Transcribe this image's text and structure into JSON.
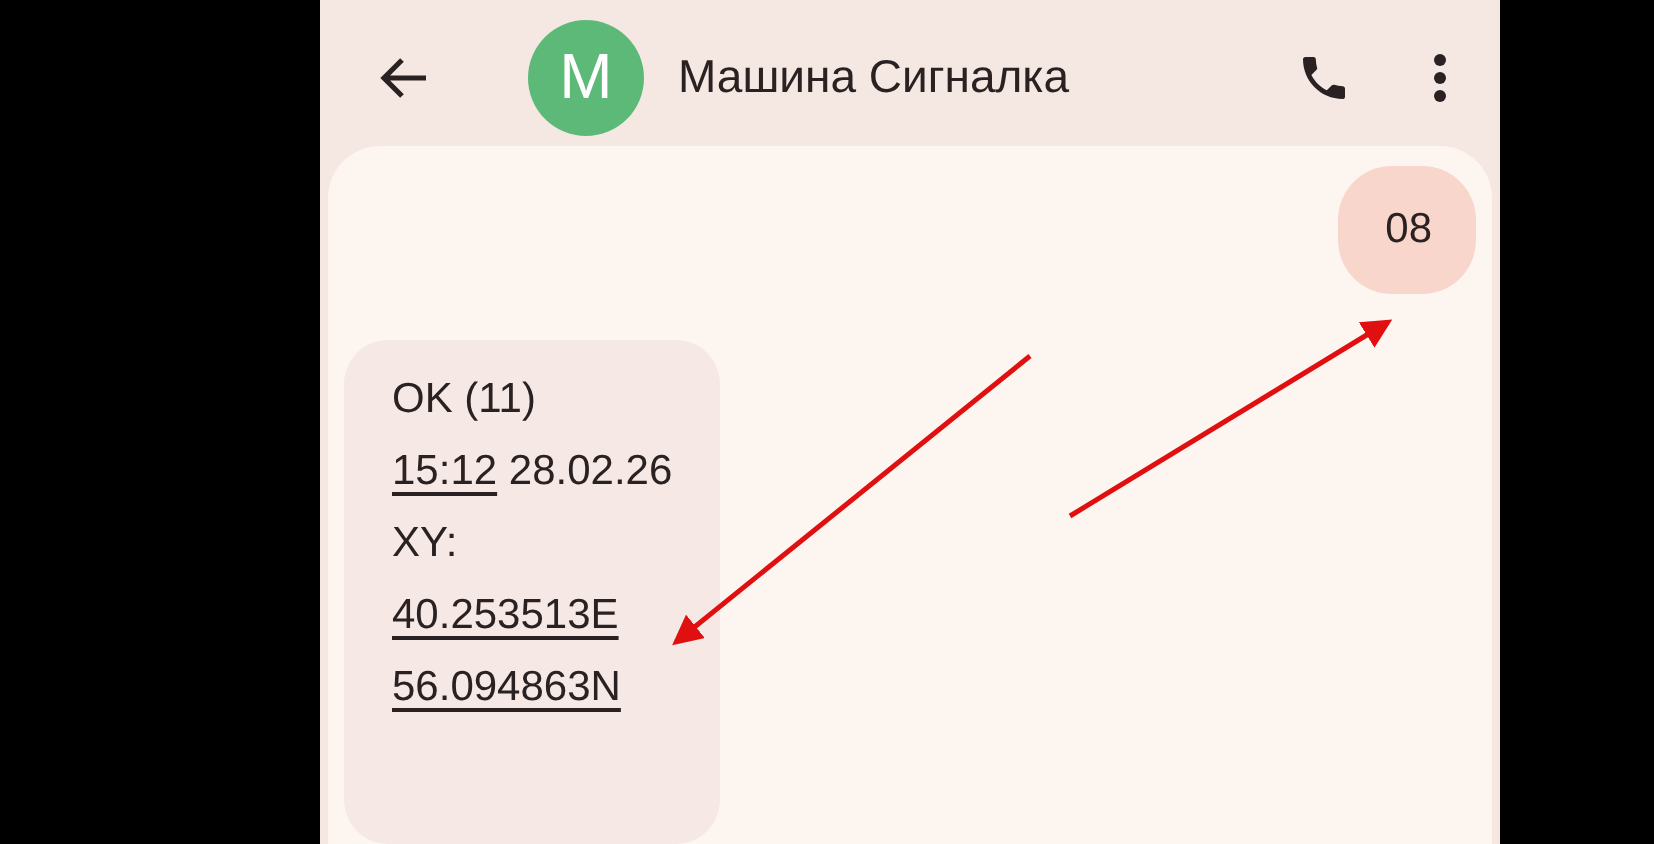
{
  "header": {
    "avatar_letter": "M",
    "title": "Машина Сигналка"
  },
  "messages": [
    {
      "kind": "sent",
      "lines": [
        [
          {
            "text": "08",
            "link": false
          }
        ]
      ]
    },
    {
      "kind": "received",
      "lines": [
        [
          {
            "text": "OK (11)",
            "link": false
          }
        ],
        [
          {
            "text": "15:12",
            "link": true
          },
          {
            "text": " 28.02.26",
            "link": false
          }
        ],
        [
          {
            "text": "XY:",
            "link": false
          }
        ],
        [
          {
            "text": "40.253513E",
            "link": true
          }
        ],
        [
          {
            "text": "56.094863N",
            "link": true
          }
        ]
      ]
    }
  ]
}
